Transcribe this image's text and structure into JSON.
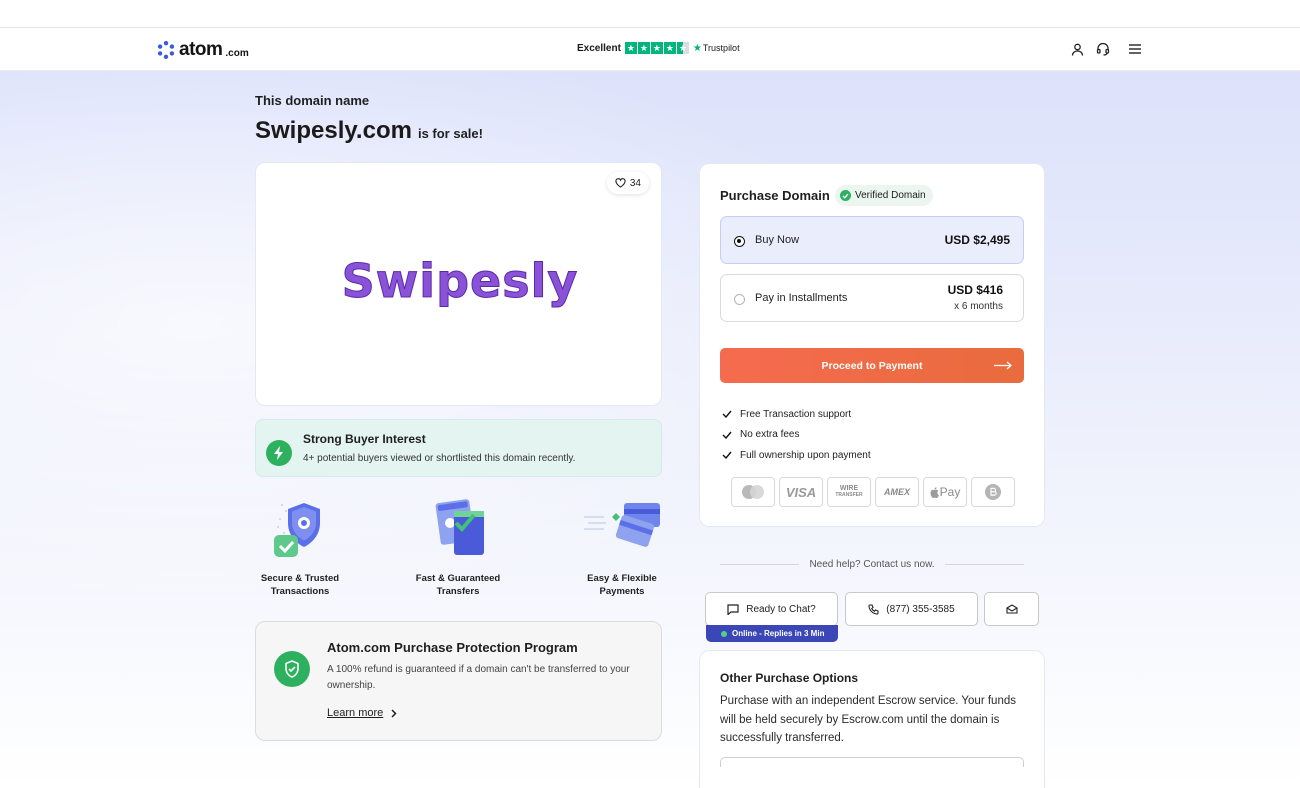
{
  "nav": {
    "logo_text": "atom",
    "logo_suffix": ".com",
    "trust_label": "Excellent",
    "trust_brand": "Trustpilot",
    "trust_stars": 4.5,
    "icons": [
      "user-icon",
      "headset-icon",
      "menu-icon"
    ]
  },
  "hero": {
    "kicker": "This domain name",
    "domain": "Swipesly.com",
    "forsale": "is for sale!"
  },
  "logo_card": {
    "likes": "34",
    "brand_name": "Swipesly",
    "brand_color": "#8a52d6"
  },
  "interest": {
    "title": "Strong Buyer Interest",
    "text": "4+ potential buyers viewed or shortlisted this domain recently."
  },
  "features": [
    {
      "label_1": "Secure & Trusted",
      "label_2": "Transactions"
    },
    {
      "label_1": "Fast & Guaranteed",
      "label_2": "Transfers"
    },
    {
      "label_1": "Easy & Flexible",
      "label_2": "Payments"
    }
  ],
  "protection": {
    "title": "Atom.com Purchase Protection Program",
    "text": "A 100% refund is guaranteed if a domain can't be transferred to your ownership.",
    "link": "Learn more"
  },
  "purchase": {
    "title": "Purchase Domain",
    "verified": "Verified Domain",
    "options": [
      {
        "label": "Buy Now",
        "price": "USD $2,495",
        "selected": true
      },
      {
        "label": "Pay in Installments",
        "price": "USD $416",
        "sub": "x 6 months",
        "selected": false
      }
    ],
    "cta": "Proceed to Payment",
    "checks": [
      "Free Transaction support",
      "No extra fees",
      "Full ownership upon payment"
    ],
    "payment_methods": [
      "mastercard",
      "VISA",
      "WIRE TRANSFER",
      "AMEX",
      "Pay",
      "bitcoin"
    ],
    "visa_text": "VISA",
    "wire_text_1": "WIRE",
    "wire_text_2": "TRANSFER",
    "amex_text": "AMEX",
    "applepay_text": "Pay"
  },
  "help": {
    "text": "Need help? Contact us now.",
    "chat": "Ready to Chat?",
    "online": "Online - Replies in 3 Min",
    "phone": "(877) 355-3585"
  },
  "other": {
    "title": "Other Purchase Options",
    "text": "Purchase with an independent Escrow service. Your funds will be held securely by Escrow.com until the domain is successfully transferred."
  },
  "colors": {
    "accent": "#2eb15f",
    "cta": "#f0683f",
    "online_bar": "#3b46b7",
    "trustpilot": "#00b67a"
  }
}
